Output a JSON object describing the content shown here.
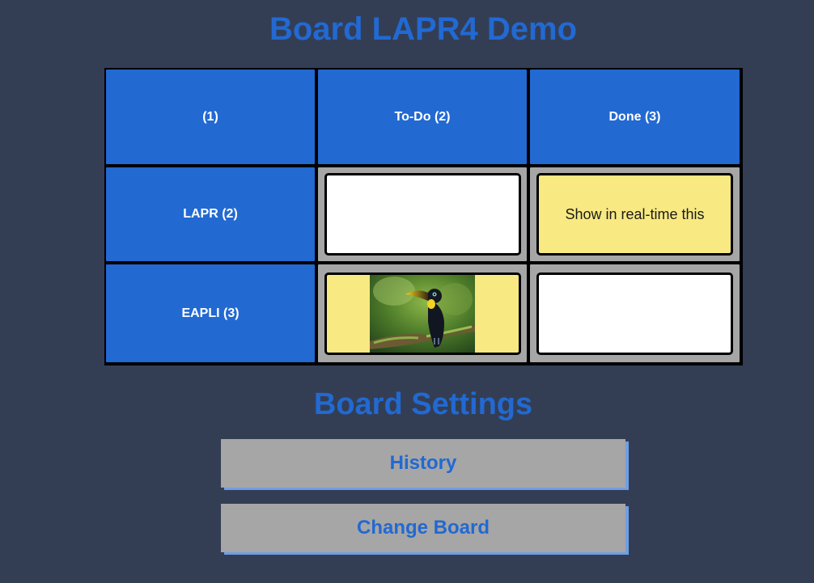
{
  "board": {
    "title": "Board LAPR4 Demo",
    "corner_header": "(1)",
    "columns": [
      {
        "label": "To-Do (2)"
      },
      {
        "label": "Done (3)"
      }
    ],
    "rows": [
      {
        "label": "LAPR (2)"
      },
      {
        "label": "EAPLI (3)"
      }
    ],
    "cards": [
      {
        "text": "",
        "color": "#ffffff"
      },
      {
        "text": "Show in real-time this",
        "color": "#f8e982"
      },
      {
        "text": "",
        "color": "#f8e982",
        "image": "toucan-photo"
      },
      {
        "text": "",
        "color": "#ffffff"
      }
    ]
  },
  "settings": {
    "title": "Board Settings",
    "history_label": "History",
    "change_board_label": "Change Board"
  },
  "colors": {
    "background": "#333e55",
    "accent": "#2269d2",
    "cell_gray": "#a6a6a6",
    "card_yellow": "#f8e982"
  }
}
